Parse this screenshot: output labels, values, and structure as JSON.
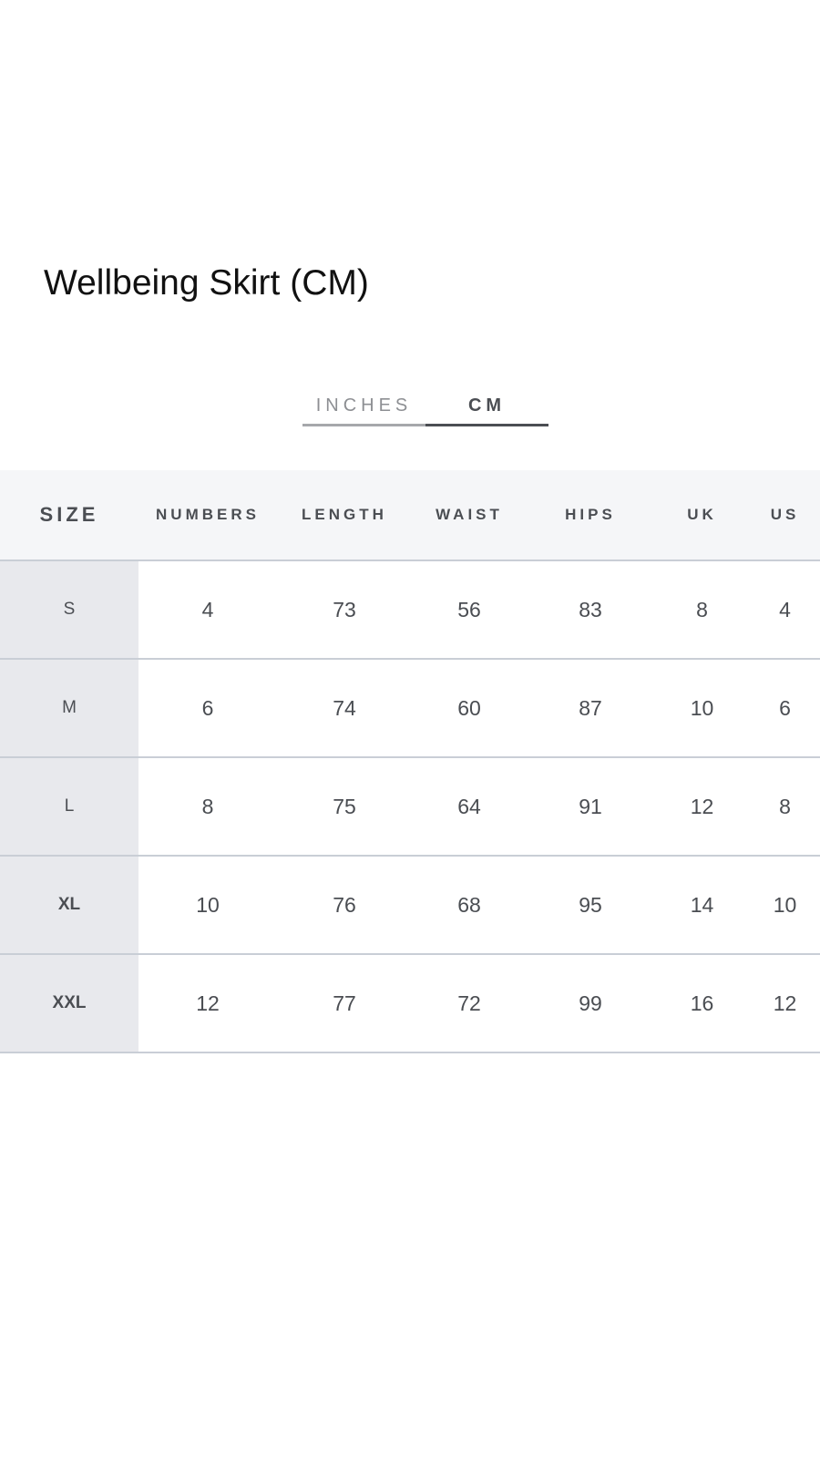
{
  "title": "Wellbeing Skirt (CM)",
  "unit_toggle": {
    "inches_label": "INCHES",
    "cm_label": "CM",
    "selected": "CM"
  },
  "table": {
    "headers": [
      "SIZE",
      "NUMBERS",
      "LENGTH",
      "WAIST",
      "HIPS",
      "UK",
      "US"
    ],
    "rows": [
      [
        "S",
        "4",
        "73",
        "56",
        "83",
        "8",
        "4"
      ],
      [
        "M",
        "6",
        "74",
        "60",
        "87",
        "10",
        "6"
      ],
      [
        "L",
        "8",
        "75",
        "64",
        "91",
        "12",
        "8"
      ],
      [
        "XL",
        "10",
        "76",
        "68",
        "95",
        "14",
        "10"
      ],
      [
        "XXL",
        "12",
        "77",
        "72",
        "99",
        "16",
        "12"
      ]
    ]
  },
  "colors": {
    "header_bg": "#f5f6f8",
    "size_column_bg": "#e8e9ed",
    "divider": "#c9ced6",
    "text": "#4a4d52",
    "title_text": "#111111"
  }
}
